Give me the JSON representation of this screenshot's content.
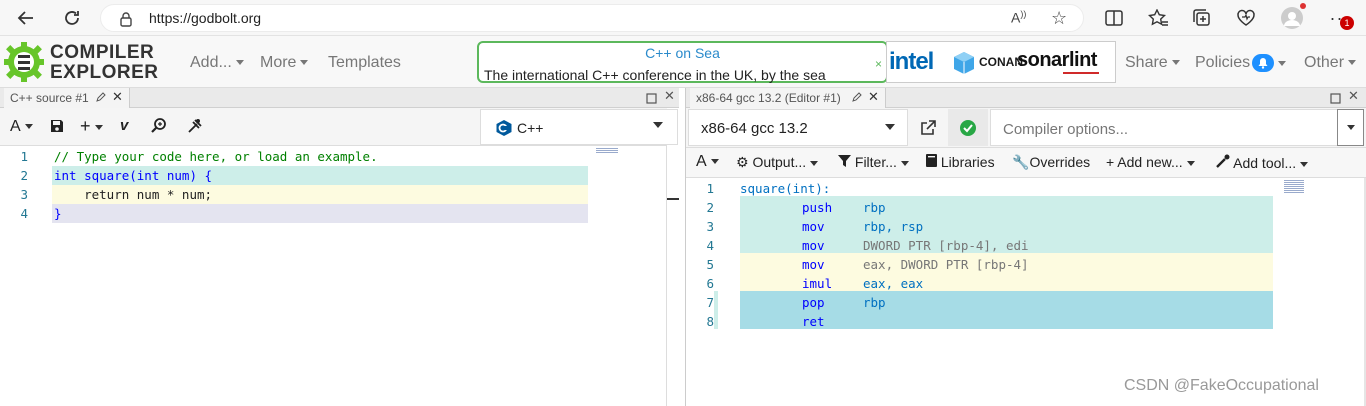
{
  "browser": {
    "url": "https://godbolt.org",
    "icons": [
      "back-arrow-icon",
      "refresh-icon",
      "lock-icon",
      "read-aloud-icon",
      "favorite-star-icon",
      "split-screen-icon",
      "favorites-icon",
      "collections-icon",
      "browser-essentials-icon",
      "profile-avatar-icon",
      "more-icon"
    ],
    "notification_count": "1"
  },
  "app": {
    "logo_line1": "COMPILER",
    "logo_line2": "EXPLORER",
    "nav": [
      "Add...",
      "More",
      "Templates"
    ],
    "right_nav": [
      "Share",
      "Policies",
      "Other"
    ],
    "promo_title": "C++ on Sea",
    "promo_text": "The international C++ conference in the UK, by the sea",
    "promo_close": "×",
    "sponsors": [
      "intel",
      "CONAN",
      "sonarlint"
    ]
  },
  "source_pane": {
    "tab_label": "C++ source #1",
    "language": "C++",
    "lines": [
      {
        "n": "1",
        "text": "// Type your code here, or load an example."
      },
      {
        "n": "2",
        "text": "int square(int num) {"
      },
      {
        "n": "3",
        "text": "    return num * num;"
      },
      {
        "n": "4",
        "text": "}"
      }
    ]
  },
  "compiler_pane": {
    "tab_label": "x86-64 gcc 13.2 (Editor #1)",
    "compiler": "x86-64 gcc 13.2",
    "options_placeholder": "Compiler options...",
    "toolbar": [
      "Output...",
      "Filter...",
      "Libraries",
      "Overrides",
      "+ Add new...",
      "Add tool..."
    ],
    "asm": [
      {
        "n": "1",
        "op": "square(int):",
        "args": ""
      },
      {
        "n": "2",
        "op": "push",
        "args": "rbp"
      },
      {
        "n": "3",
        "op": "mov",
        "args": "rbp, rsp"
      },
      {
        "n": "4",
        "op": "mov",
        "args": "DWORD PTR [rbp-4], edi"
      },
      {
        "n": "5",
        "op": "mov",
        "args": "eax, DWORD PTR [rbp-4]"
      },
      {
        "n": "6",
        "op": "imul",
        "args": "eax, eax"
      },
      {
        "n": "7",
        "op": "pop",
        "args": "rbp"
      },
      {
        "n": "8",
        "op": "ret",
        "args": ""
      }
    ]
  },
  "watermark": "CSDN @FakeOccupational",
  "colors": {
    "highlight_teal": "#cdeee9",
    "highlight_yellow": "#fdfbe0",
    "highlight_blue": "#a6dce6",
    "highlight_lavender": "#e4e4f0",
    "logo_green": "#67c52a"
  }
}
